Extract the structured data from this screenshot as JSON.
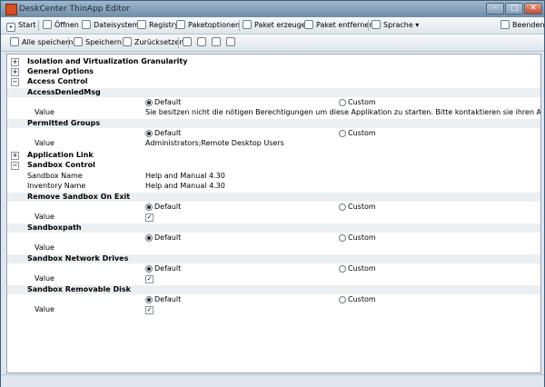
{
  "window": {
    "title": "DeskCenter ThinApp Editor"
  },
  "toolbar1": {
    "start": "Start",
    "oeffnen": "Öffnen",
    "dateisystem": "Dateisystem",
    "registry": "Registry",
    "paketoptionen": "Paketoptionen",
    "paket_erzeugen": "Paket erzeugen",
    "paket_entfernen": "Paket entfernen",
    "sprache": "Sprache",
    "beenden": "Beenden"
  },
  "toolbar2": {
    "alle_speichern": "Alle speichern",
    "speichern": "Speichern",
    "zuruecksetzen": "Zurücksetzen"
  },
  "tree": {
    "isolation": "Isolation and Virtualization Granularity",
    "general": "General Options",
    "access_control": "Access Control",
    "access_denied_msg": "AccessDeniedMsg",
    "default": "Default",
    "custom": "Custom",
    "value": "Value",
    "access_denied_value": "Sie besitzen nicht die nötigen Berechtigungen um diese Applikation zu starten. Bitte kontaktieren sie ihren Administrator.",
    "permitted_groups": "Permitted Groups",
    "permitted_groups_value": "Administrators;Remote Desktop Users",
    "application_link": "Application Link",
    "sandbox_control": "Sandbox Control",
    "sandbox_name_label": "Sandbox Name",
    "sandbox_name_value": "Help and Manual 4.30",
    "inventory_name_label": "Inventory Name",
    "inventory_name_value": "Help and Manual 4.30",
    "remove_sandbox": "Remove Sandbox On Exit",
    "sandboxpath": "Sandboxpath",
    "sandbox_network": "Sandbox Network Drives",
    "sandbox_removable": "Sandbox Removable Disk"
  }
}
